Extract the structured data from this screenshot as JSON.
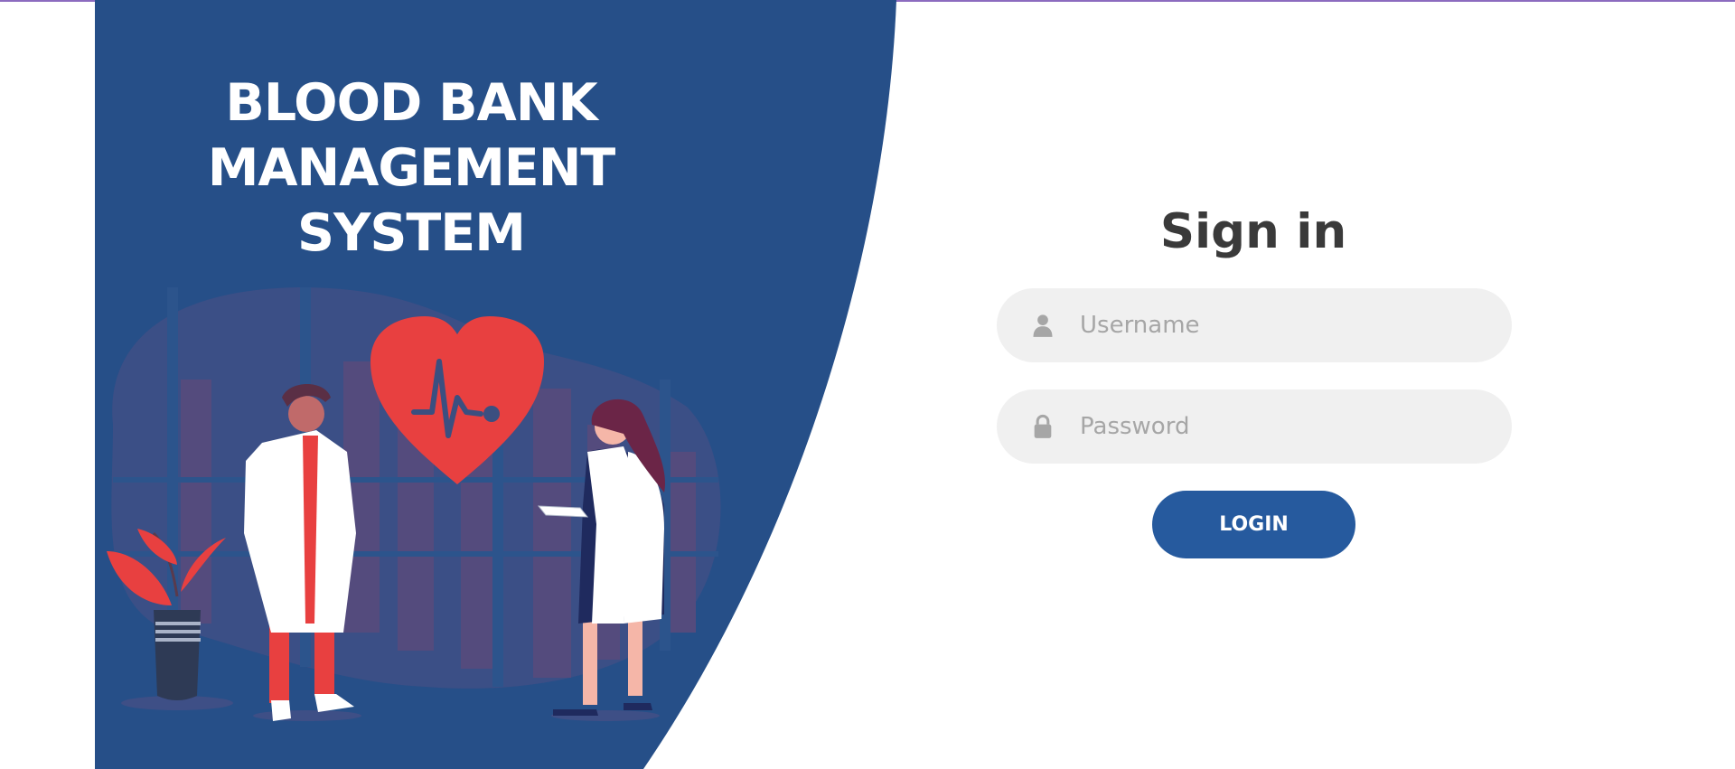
{
  "app": {
    "title_lines": [
      "BLOOD BANK",
      "MANAGEMENT",
      "SYSTEM"
    ]
  },
  "login": {
    "heading": "Sign in",
    "username": {
      "placeholder": "Username",
      "value": "",
      "icon": "user-icon"
    },
    "password": {
      "placeholder": "Password",
      "value": "",
      "icon": "lock-icon"
    },
    "submit_label": "LOGIN"
  },
  "colors": {
    "panel_blue": "#264f88",
    "accent_blue": "#265a9e",
    "heart_red": "#e84040",
    "field_bg": "#f0f0f0",
    "heading_text": "#3a3a3a",
    "top_line": "#8c6bbf"
  }
}
